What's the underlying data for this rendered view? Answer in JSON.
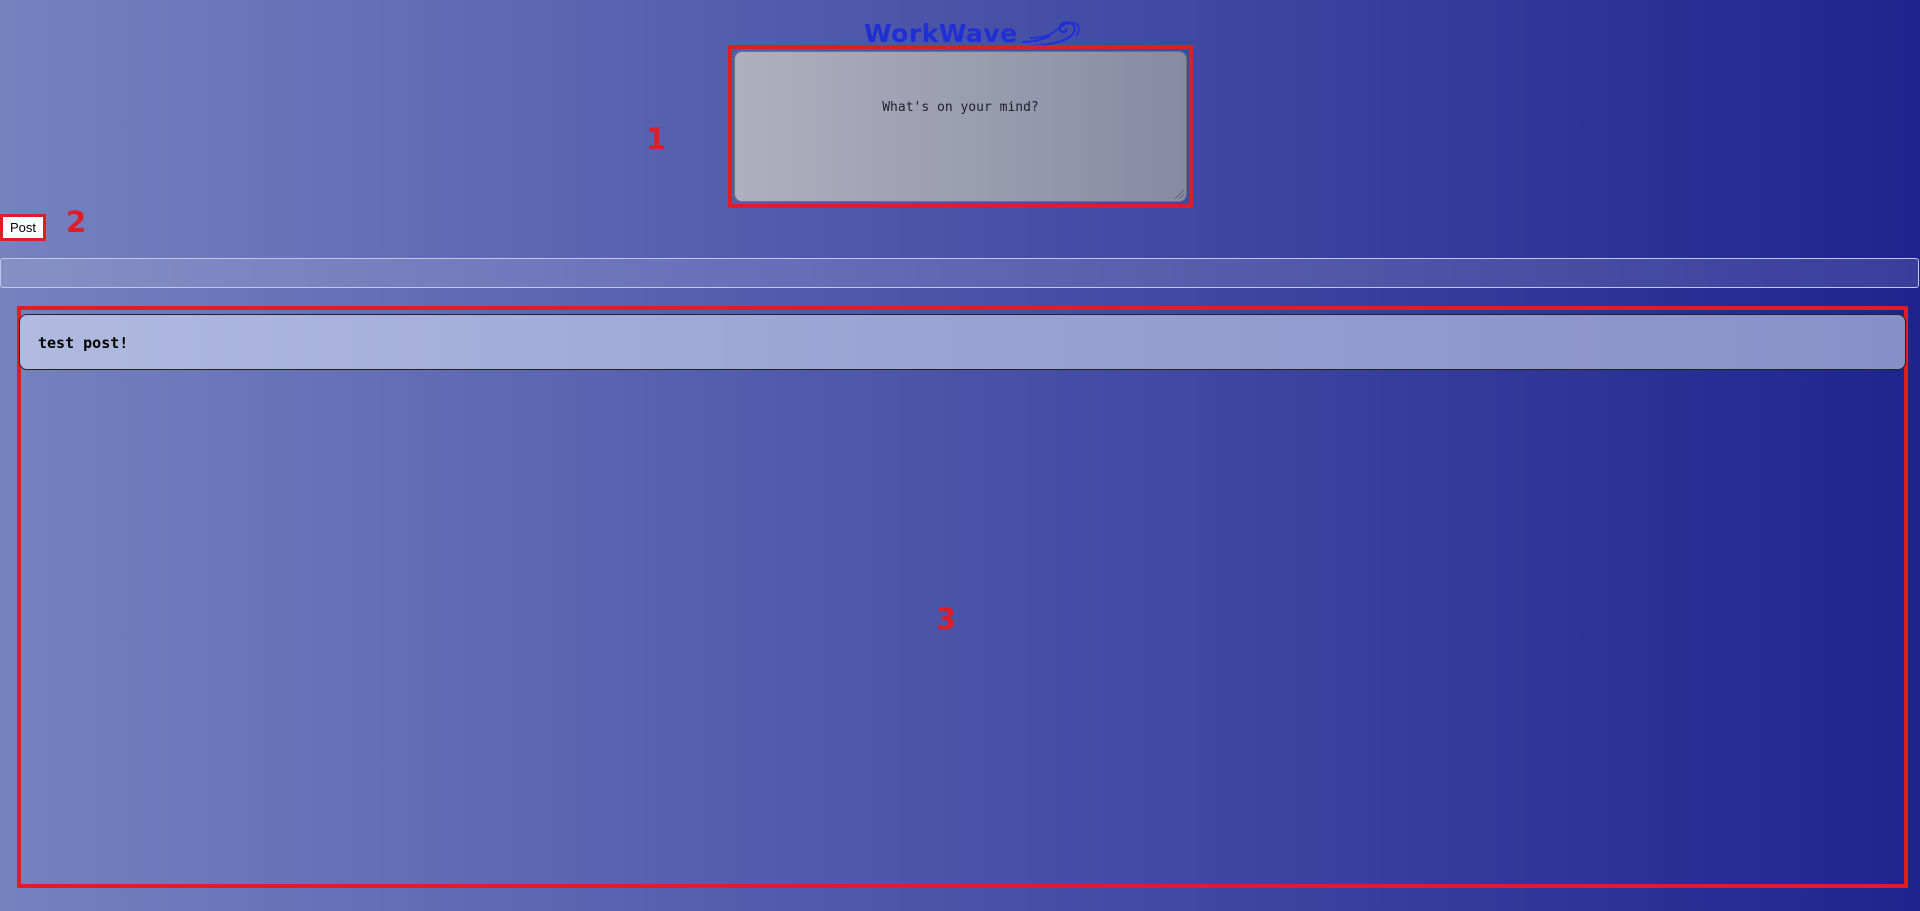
{
  "header": {
    "logo_text": "WorkWave",
    "logo_icon": "wave-icon"
  },
  "composer": {
    "placeholder": "What's on your mind?",
    "value": ""
  },
  "actions": {
    "post_label": "Post"
  },
  "search": {
    "placeholder": "",
    "value": ""
  },
  "feed": {
    "posts": [
      {
        "text": "test post!"
      }
    ]
  },
  "annotations": {
    "one": "1",
    "two": "2",
    "three": "3"
  },
  "colors": {
    "background_left": "#7582be",
    "background_right": "#1d248d",
    "logo": "#1e2fd6",
    "annotation": "#e01c24"
  }
}
